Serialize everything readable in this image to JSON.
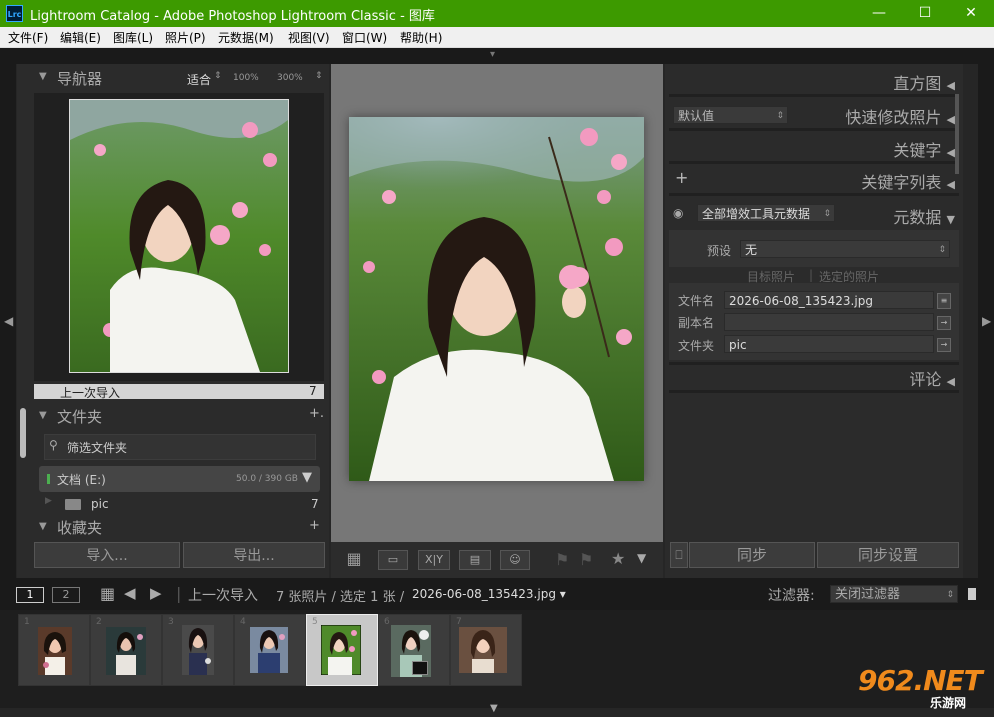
{
  "window": {
    "title": "Lightroom Catalog - Adobe Photoshop Lightroom Classic - 图库",
    "logo": "Lrc",
    "minimize": "—",
    "maximize": "☐",
    "close": "✕"
  },
  "menu": [
    "文件(F)",
    "编辑(E)",
    "图库(L)",
    "照片(P)",
    "元数据(M)",
    "视图(V)",
    "窗口(W)",
    "帮助(H)"
  ],
  "navigator": {
    "title": "导航器",
    "fit": "适合",
    "zoom1": "100%",
    "zoom2": "300%"
  },
  "source": {
    "label": "上一次导入",
    "count": "7"
  },
  "folders": {
    "title": "文件夹",
    "filter_placeholder": "筛选文件夹",
    "volume": {
      "name": "文档 (E:)",
      "usage": "50.0 / 390 GB"
    },
    "items": [
      {
        "name": "pic",
        "count": "7"
      }
    ],
    "add": "+."
  },
  "collections": {
    "title": "收藏夹"
  },
  "buttons": {
    "import": "导入...",
    "export": "导出...",
    "sync": "同步",
    "sync_settings": "同步设置"
  },
  "right": {
    "histogram": "直方图",
    "quick_develop": "快速修改照片",
    "preset_default": "默认值",
    "keywords": "关键字",
    "keyword_list": "关键字列表",
    "keyword_add": "+",
    "metadata": "元数据",
    "metadata_preset_select": "全部增效工具元数据",
    "preset_label": "预设",
    "preset_value": "无",
    "target_photo": "目标照片",
    "selected_photo": "选定的照片",
    "fields": [
      {
        "label": "文件名",
        "value": "2026-06-08_135423.jpg"
      },
      {
        "label": "副本名",
        "value": ""
      },
      {
        "label": "文件夹",
        "value": "pic"
      }
    ],
    "comments": "评论"
  },
  "filmbar": {
    "page1": "1",
    "page2": "2",
    "source": "上一次导入",
    "summary": "7 张照片 / 选定 1 张 /",
    "filename": "2026-06-08_135423.jpg ▾",
    "filter_label": "过滤器:",
    "filter_value": "关闭过滤器"
  },
  "filmstrip": {
    "cells": [
      "1",
      "2",
      "3",
      "4",
      "5",
      "6",
      "7"
    ],
    "selected_index": 5
  },
  "watermark": {
    "text": "962.NET",
    "sub": "乐游网"
  },
  "colors": {
    "title_bar": "#3d9a00",
    "panel": "#2b2b2b",
    "center": "#777777"
  }
}
